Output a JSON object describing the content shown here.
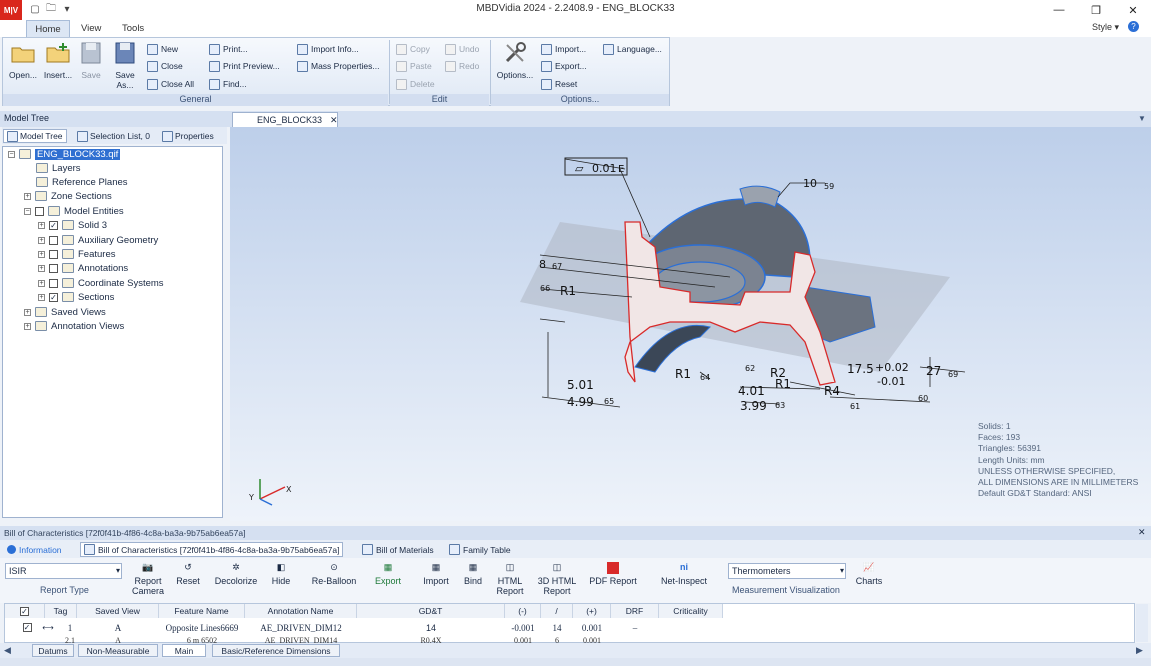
{
  "app": {
    "logo_text": "M|V",
    "title": "MBDVidia 2024 - 2.2408.9 - ENG_BLOCK33",
    "window_controls": {
      "minimize": "—",
      "maximize": "❐",
      "close": "✕"
    }
  },
  "menu_tabs": [
    "Home",
    "View",
    "Tools"
  ],
  "style_menu": "Style",
  "help_label": "?",
  "ribbon": {
    "general": {
      "label": "General",
      "open": "Open...",
      "insert": "Insert...",
      "save": "Save",
      "save_as": "Save As...",
      "new": "New",
      "close": "Close",
      "close_all": "Close All",
      "print": "Print...",
      "print_preview": "Print Preview...",
      "find": "Find...",
      "import_info": "Import Info...",
      "mass_properties": "Mass Properties..."
    },
    "edit": {
      "label": "Edit",
      "copy": "Copy",
      "undo": "Undo",
      "paste": "Paste",
      "redo": "Redo",
      "delete": "Delete"
    },
    "options": {
      "label": "Options...",
      "options": "Options...",
      "import": "Import...",
      "export": "Export...",
      "reset": "Reset",
      "language": "Language..."
    }
  },
  "model_tree": {
    "title": "Model Tree",
    "tabs": [
      "Model Tree",
      "Selection List, 0",
      "Properties"
    ],
    "root": "ENG_BLOCK33.qif",
    "items": {
      "layers": "Layers",
      "reference_planes": "Reference Planes",
      "zone_sections": "Zone Sections",
      "model_entities": "Model Entities",
      "solid": "Solid 3",
      "aux_geometry": "Auxiliary Geometry",
      "features": "Features",
      "annotations": "Annotations",
      "coord_systems": "Coordinate Systems",
      "sections": "Sections",
      "saved_views": "Saved Views",
      "annotation_views": "Annotation Views"
    }
  },
  "document_tab": "ENG_BLOCK33",
  "viewport": {
    "annotations": {
      "flatness": "0.01",
      "flatness_ref": "E",
      "dim_10": "10",
      "dim_10_ref": "59",
      "dim_8": "8",
      "dim_8_ref": "67",
      "dim_r1_top": "R1",
      "dim_r1_top_ref": "66",
      "dim_5_upper": "5.01",
      "dim_5_lower": "4.99",
      "dim_5_ref": "65",
      "dim_r1_bottom": "R1",
      "dim_r1_bottom_ref": "64",
      "dim_4_upper": "4.01",
      "dim_4_lower": "3.99",
      "dim_4_ref": "63",
      "dim_r2": "R2",
      "dim_r2_ref": "62",
      "dim_r1_mid": "R1",
      "dim_r4": "R4",
      "dim_r4_ref": "61",
      "dim_17_5": "17.5",
      "tol_plus": "+0.02",
      "tol_minus": "-0.01",
      "dim_27": "27",
      "dim_27_ref": "69",
      "dim_ref_60": "60"
    },
    "axis_labels": {
      "x": "X",
      "y": "Y",
      "z": "Z"
    },
    "info_lines": [
      "Solids: 1",
      "Faces: 193",
      "Triangles: 56391",
      "Length Units: mm",
      "UNLESS OTHERWISE SPECIFIED,",
      "ALL DIMENSIONS ARE IN MILLIMETERS",
      "Default GD&T Standard: ANSI"
    ]
  },
  "bottom_panel": {
    "title": "Bill of Characteristics [72f0f41b-4f86-4c8a-ba3a-9b75ab6ea57a]",
    "tabs": [
      "Information",
      "Bill of Characteristics [72f0f41b-4f86-4c8a-ba3a-9b75ab6ea57a]",
      "Bill of Materials",
      "Family Table"
    ],
    "report_type_value": "ISIR",
    "report_type_label": "Report Type",
    "buttons": [
      "Report Camera",
      "Reset",
      "Decolorize",
      "Hide",
      "Re-Balloon",
      "Export",
      "Import",
      "Bind",
      "HTML Report",
      "3D HTML Report",
      "PDF Report",
      "Net-Inspect"
    ],
    "measurement_value": "Thermometers",
    "measurement_label": "Measurement Visualization",
    "charts": "Charts",
    "columns": [
      "Tag",
      "Saved View",
      "Feature Name",
      "Annotation Name",
      "GD&T",
      "(-)",
      "/",
      "(+)",
      "DRF",
      "Criticality"
    ],
    "rows": [
      {
        "tag": "1",
        "saved_view": "A",
        "feature": "Opposite Lines6669",
        "annotation": "AE_DRIVEN_DIM12",
        "gdt": "14",
        "minus": "-0.001",
        "nominal": "14",
        "plus": "0.001",
        "drf": "–",
        "criticality": ""
      },
      {
        "tag": "2.1",
        "saved_view": "A",
        "feature": "6 m 6502",
        "annotation": "AE_DRIVEN_DIM14",
        "gdt": "R0.4X",
        "minus": "0.001",
        "nominal": "6",
        "plus": "0.001",
        "drf": "",
        "criticality": ""
      }
    ],
    "sheet_tabs": [
      "Datums",
      "Non-Measurable",
      "Main",
      "Basic/Reference Dimensions"
    ]
  }
}
